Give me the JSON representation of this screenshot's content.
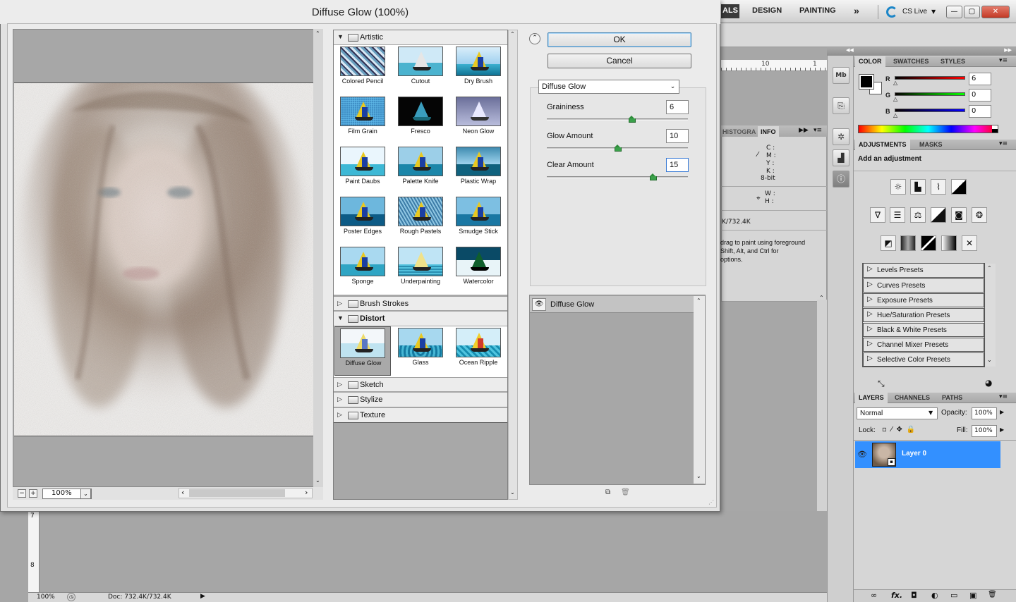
{
  "app": {
    "workspaces": [
      "ALS",
      "DESIGN",
      "PAINTING",
      "»"
    ],
    "cs_live": "CS Live",
    "win_controls": [
      "—",
      "▢",
      "✕"
    ],
    "ruler_numbers": [
      "10",
      "1"
    ],
    "info_panel": {
      "tabs": [
        "HISTOGRA",
        "INFO"
      ],
      "cmyk": [
        "C :",
        "M :",
        "Y :",
        "K :"
      ],
      "bit_depth": "8-bit",
      "wh": [
        "W :",
        "H :"
      ],
      "doc_size": "K/732.4K",
      "hint": [
        "drag to paint using foreground",
        "Shift, Alt, and Ctrl for",
        "options."
      ]
    },
    "status": {
      "zoom": "100%",
      "doc": "Doc: 732.4K/732.4K"
    },
    "left_ruler_numbers": [
      "7",
      "8"
    ],
    "color_panel": {
      "tabs": [
        "COLOR",
        "SWATCHES",
        "STYLES"
      ],
      "r": "6",
      "g": "0",
      "b": "0",
      "labels": [
        "R",
        "G",
        "B"
      ]
    },
    "adjustments_panel": {
      "tabs": [
        "ADJUSTMENTS",
        "MASKS"
      ],
      "heading": "Add an adjustment",
      "presets": [
        "Levels Presets",
        "Curves Presets",
        "Exposure Presets",
        "Hue/Saturation Presets",
        "Black & White Presets",
        "Channel Mixer Presets",
        "Selective Color Presets"
      ]
    },
    "layers_panel": {
      "tabs": [
        "LAYERS",
        "CHANNELS",
        "PATHS"
      ],
      "blend_mode": "Normal",
      "opacity_label": "Opacity:",
      "opacity": "100%",
      "lock_label": "Lock:",
      "fill_label": "Fill:",
      "fill": "100%",
      "layer_name": "Layer 0",
      "footer_icons": [
        "∞",
        "fx.",
        "◘",
        "◐",
        "▭",
        "▣",
        "🗑"
      ]
    }
  },
  "dialog": {
    "title": "Diffuse Glow (100%)",
    "zoom": "100%",
    "ok": "OK",
    "cancel": "Cancel",
    "filter": "Diffuse Glow",
    "params": [
      {
        "label": "Graininess",
        "value": "6",
        "pos": 0.6
      },
      {
        "label": "Glow Amount",
        "value": "10",
        "pos": 0.5
      },
      {
        "label": "Clear Amount",
        "value": "15",
        "pos": 0.75
      }
    ],
    "effect_layer": "Diffuse Glow",
    "categories": {
      "artistic": {
        "name": "Artistic",
        "items": [
          "Colored Pencil",
          "Cutout",
          "Dry Brush",
          "Film Grain",
          "Fresco",
          "Neon Glow",
          "Paint Daubs",
          "Palette Knife",
          "Plastic Wrap",
          "Poster Edges",
          "Rough Pastels",
          "Smudge Stick",
          "Sponge",
          "Underpainting",
          "Watercolor"
        ]
      },
      "brush_strokes": "Brush Strokes",
      "distort": {
        "name": "Distort",
        "items": [
          "Diffuse Glow",
          "Glass",
          "Ocean Ripple"
        ]
      },
      "sketch": "Sketch",
      "stylize": "Stylize",
      "texture": "Texture"
    }
  }
}
